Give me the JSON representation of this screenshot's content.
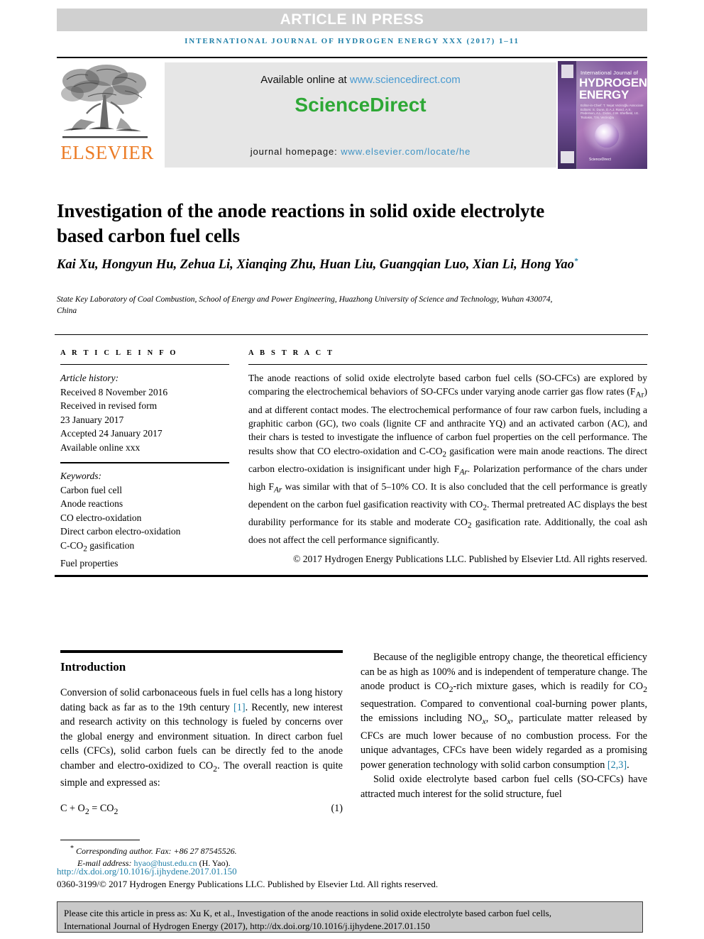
{
  "banner": {
    "label": "ARTICLE IN PRESS"
  },
  "running_head": "INTERNATIONAL JOURNAL OF HYDROGEN ENERGY XXX (2017) 1–11",
  "header": {
    "elsevier_wordmark": "ELSEVIER",
    "available_prefix": "Available online at ",
    "available_url": "www.sciencedirect.com",
    "sciencedirect_logo": "ScienceDirect",
    "homepage_prefix": "journal homepage: ",
    "homepage_url": "www.elsevier.com/locate/he",
    "cover": {
      "line_small": "International Journal of",
      "line_hydrogen": "HYDROGEN",
      "line_energy": "ENERGY",
      "editors": "Editor-in-Chief: T. Nejat Veziroğlu    Associate Editors: S. Dunn, D.A.J. Rand, A.S. Pedersen, A.L. Dicks, J.W. Sheffield, I.E. Tsolakis, T.N. Veziroğlu",
      "sciencedirect": "ScienceDirect"
    }
  },
  "article": {
    "title": "Investigation of the anode reactions in solid oxide electrolyte based carbon fuel cells",
    "authors": "Kai Xu, Hongyun Hu, Zehua Li, Xianqing Zhu, Huan Liu, Guangqian Luo, Xian Li, Hong Yao",
    "author_marker": "*",
    "affiliation": "State Key Laboratory of Coal Combustion, School of Energy and Power Engineering, Huazhong University of Science and Technology, Wuhan 430074, China"
  },
  "article_info": {
    "heading": "A R T I C L E  I N F O",
    "history_label": "Article history:",
    "history": [
      "Received 8 November 2016",
      "Received in revised form",
      "23 January 2017",
      "Accepted 24 January 2017",
      "Available online xxx"
    ],
    "keywords_label": "Keywords:",
    "keywords": [
      "Carbon fuel cell",
      "Anode reactions",
      "CO electro-oxidation",
      "Direct carbon electro-oxidation",
      "C-CO2 gasification",
      "Fuel properties"
    ]
  },
  "abstract": {
    "heading": "A B S T R A C T",
    "body": "The anode reactions of solid oxide electrolyte based carbon fuel cells (SO-CFCs) are explored by comparing the electrochemical behaviors of SO-CFCs under varying anode carrier gas flow rates (FAr) and at different contact modes. The electrochemical performance of four raw carbon fuels, including a graphitic carbon (GC), two coals (lignite CF and anthracite YQ) and an activated carbon (AC), and their chars is tested to investigate the influence of carbon fuel properties on the cell performance. The results show that CO electro-oxidation and C-CO2 gasification were main anode reactions. The direct carbon electro-oxidation is insignificant under high FAr. Polarization performance of the chars under high FAr was similar with that of 5–10% CO. It is also concluded that the cell performance is greatly dependent on the carbon fuel gasification reactivity with CO2. Thermal pretreated AC displays the best durability performance for its stable and moderate CO2 gasification rate. Additionally, the coal ash does not affect the cell performance significantly.",
    "copyright": "© 2017 Hydrogen Energy Publications LLC. Published by Elsevier Ltd. All rights reserved."
  },
  "body": {
    "intro_heading": "Introduction",
    "left_paragraph": "Conversion of solid carbonaceous fuels in fuel cells has a long history dating back as far as to the 19th century [1]. Recently, new interest and research activity on this technology is fueled by concerns over the global energy and environment situation. In direct carbon fuel cells (CFCs), solid carbon fuels can be directly fed to the anode chamber and electro-oxidized to CO2. The overall reaction is quite simple and expressed as:",
    "equation": "C + O2 = CO2",
    "equation_number": "(1)",
    "right_paragraph_1": "Because of the negligible entropy change, the theoretical efficiency can be as high as 100% and is independent of temperature change. The anode product is CO2-rich mixture gases, which is readily for CO2 sequestration. Compared to conventional coal-burning power plants, the emissions including NOx, SOx, particulate matter released by CFCs are much lower because of no combustion process. For the unique advantages, CFCs have been widely regarded as a promising power generation technology with solid carbon consumption [2,3].",
    "right_paragraph_2": "Solid oxide electrolyte based carbon fuel cells (SO-CFCs) have attracted much interest for the solid structure, fuel"
  },
  "footer": {
    "corresponding_marker": "*",
    "corresponding": "Corresponding author. Fax: +86 27 87545526.",
    "email_label": "E-mail address:",
    "email": "hyao@hust.edu.cn",
    "email_suffix": "(H. Yao).",
    "doi": "http://dx.doi.org/10.1016/j.ijhydene.2017.01.150",
    "issn_line": "0360-3199/© 2017 Hydrogen Energy Publications LLC. Published by Elsevier Ltd. All rights reserved."
  },
  "cite_box": {
    "line1": "Please cite this article in press as: Xu K, et al., Investigation of the anode reactions in solid oxide electrolyte based carbon fuel cells,",
    "line2": "International Journal of Hydrogen Energy (2017), http://dx.doi.org/10.1016/j.ijhydene.2017.01.150"
  },
  "colors": {
    "accent_blue": "#1f7fa8",
    "sciencedirect_green": "#2ea836",
    "elsevier_orange": "#ec7c26",
    "banner_grey": "#d0d0d0",
    "band_grey": "#e6e6e6",
    "cite_grey": "#c9c9c9"
  }
}
